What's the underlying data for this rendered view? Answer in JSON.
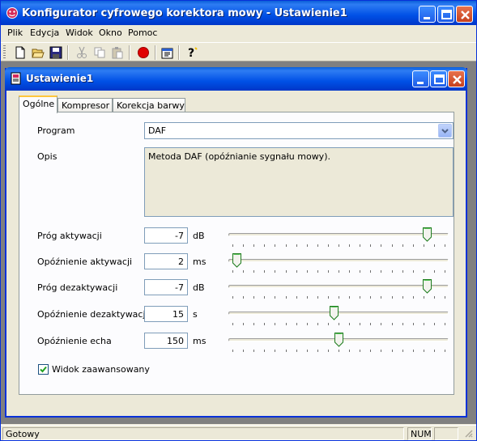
{
  "app": {
    "title": "Konfigurator cyfrowego korektora mowy - Ustawienie1",
    "menu": [
      {
        "label": "Plik"
      },
      {
        "label": "Edycja"
      },
      {
        "label": "Widok"
      },
      {
        "label": "Okno"
      },
      {
        "label": "Pomoc"
      }
    ],
    "toolbar": [
      "new-file-icon",
      "open-folder-icon",
      "save-icon",
      "cut-icon",
      "copy-icon",
      "paste-icon",
      "record-icon",
      "properties-icon",
      "help-icon"
    ]
  },
  "child": {
    "title": "Ustawienie1",
    "tabs": [
      {
        "label": "Ogólne",
        "active": true
      },
      {
        "label": "Kompresor",
        "active": false
      },
      {
        "label": "Korekcja barwy",
        "active": false
      }
    ],
    "program_label": "Program",
    "program_value": "DAF",
    "opis_label": "Opis",
    "opis_value": "Metoda DAF (opóźnianie sygnału mowy).",
    "params": [
      {
        "label": "Próg aktywacji",
        "value": "-7",
        "unit": "dB",
        "slider": 0.92
      },
      {
        "label": "Opóźnienie aktywacji",
        "value": "2",
        "unit": "ms",
        "slider": 0.02
      },
      {
        "label": "Próg dezaktywacji",
        "value": "-7",
        "unit": "dB",
        "slider": 0.92
      },
      {
        "label": "Opóźnienie dezaktywacji",
        "value": "15",
        "unit": "s",
        "slider": 0.48
      },
      {
        "label": "Opóźnienie echa",
        "value": "150",
        "unit": "ms",
        "slider": 0.5
      }
    ],
    "advanced_view_label": "Widok zaawansowany",
    "advanced_view_checked": true
  },
  "status": {
    "text": "Gotowy",
    "num": "NUM"
  },
  "colors": {
    "titlebar": "#0054E3",
    "face": "#ECE9D8",
    "record": "#E00000"
  }
}
